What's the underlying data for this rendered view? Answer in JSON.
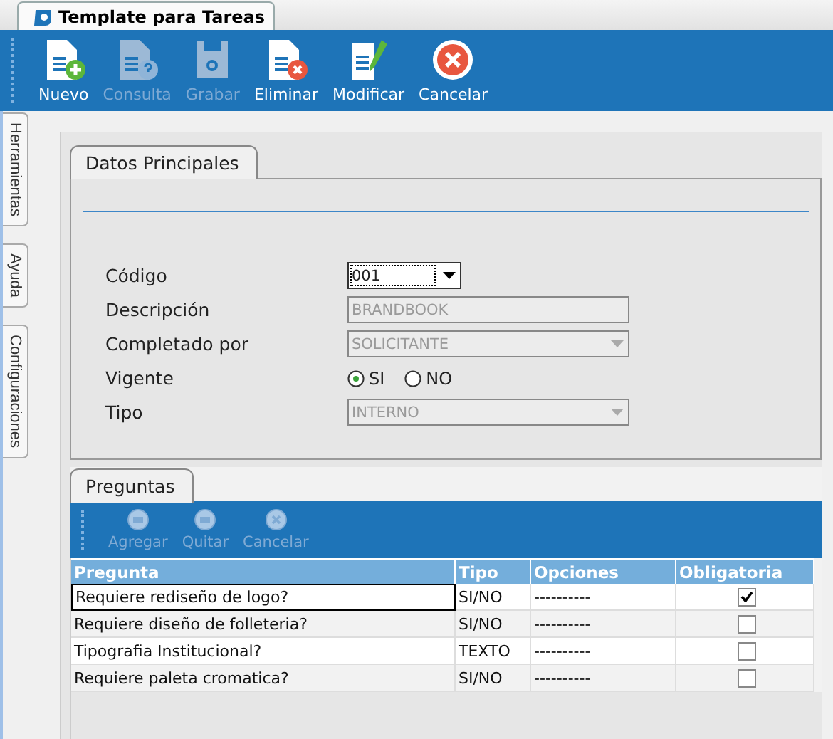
{
  "window": {
    "title": "Template para Tareas"
  },
  "toolbar": [
    {
      "label": "Nuevo",
      "disabled": false
    },
    {
      "label": "Consulta",
      "disabled": true
    },
    {
      "label": "Grabar",
      "disabled": true
    },
    {
      "label": "Eliminar",
      "disabled": false
    },
    {
      "label": "Modificar",
      "disabled": false
    },
    {
      "label": "Cancelar",
      "disabled": false
    }
  ],
  "side_tabs": [
    "Herramientas",
    "Ayuda",
    "Configuraciones"
  ],
  "main_tab": "Datos Principales",
  "fields": [
    {
      "kind": "combo",
      "label": "Código",
      "value": "001",
      "disabled": false
    },
    {
      "kind": "text",
      "label": "Descripción",
      "value": "BRANDBOOK",
      "disabled": true
    },
    {
      "kind": "combo",
      "label": "Completado por",
      "value": "SOLICITANTE",
      "disabled": true
    },
    {
      "kind": "radio",
      "label": "Vigente",
      "options": [
        {
          "label": "SI",
          "selected": true
        },
        {
          "label": "NO",
          "selected": false
        }
      ]
    },
    {
      "kind": "combo",
      "label": "Tipo",
      "value": "INTERNO",
      "disabled": true
    }
  ],
  "questions": {
    "tab": "Preguntas",
    "toolbar": [
      {
        "label": "Agregar",
        "disabled": true
      },
      {
        "label": "Quitar",
        "disabled": true
      },
      {
        "label": "Cancelar",
        "disabled": true
      }
    ],
    "columns": [
      "Pregunta",
      "Tipo",
      "Opciones",
      "Obligatoria"
    ],
    "rows": [
      {
        "pregunta": "Requiere rediseño de logo?",
        "tipo": "SI/NO",
        "opciones": "----------",
        "obligatoria": true,
        "selected": true
      },
      {
        "pregunta": "Requiere diseño de folleteria?",
        "tipo": "SI/NO",
        "opciones": "----------",
        "obligatoria": false,
        "selected": false
      },
      {
        "pregunta": "Tipografia Institucional?",
        "tipo": "TEXTO",
        "opciones": "----------",
        "obligatoria": false,
        "selected": false
      },
      {
        "pregunta": "Requiere paleta cromatica?",
        "tipo": "SI/NO",
        "opciones": "----------",
        "obligatoria": false,
        "selected": false
      }
    ]
  }
}
